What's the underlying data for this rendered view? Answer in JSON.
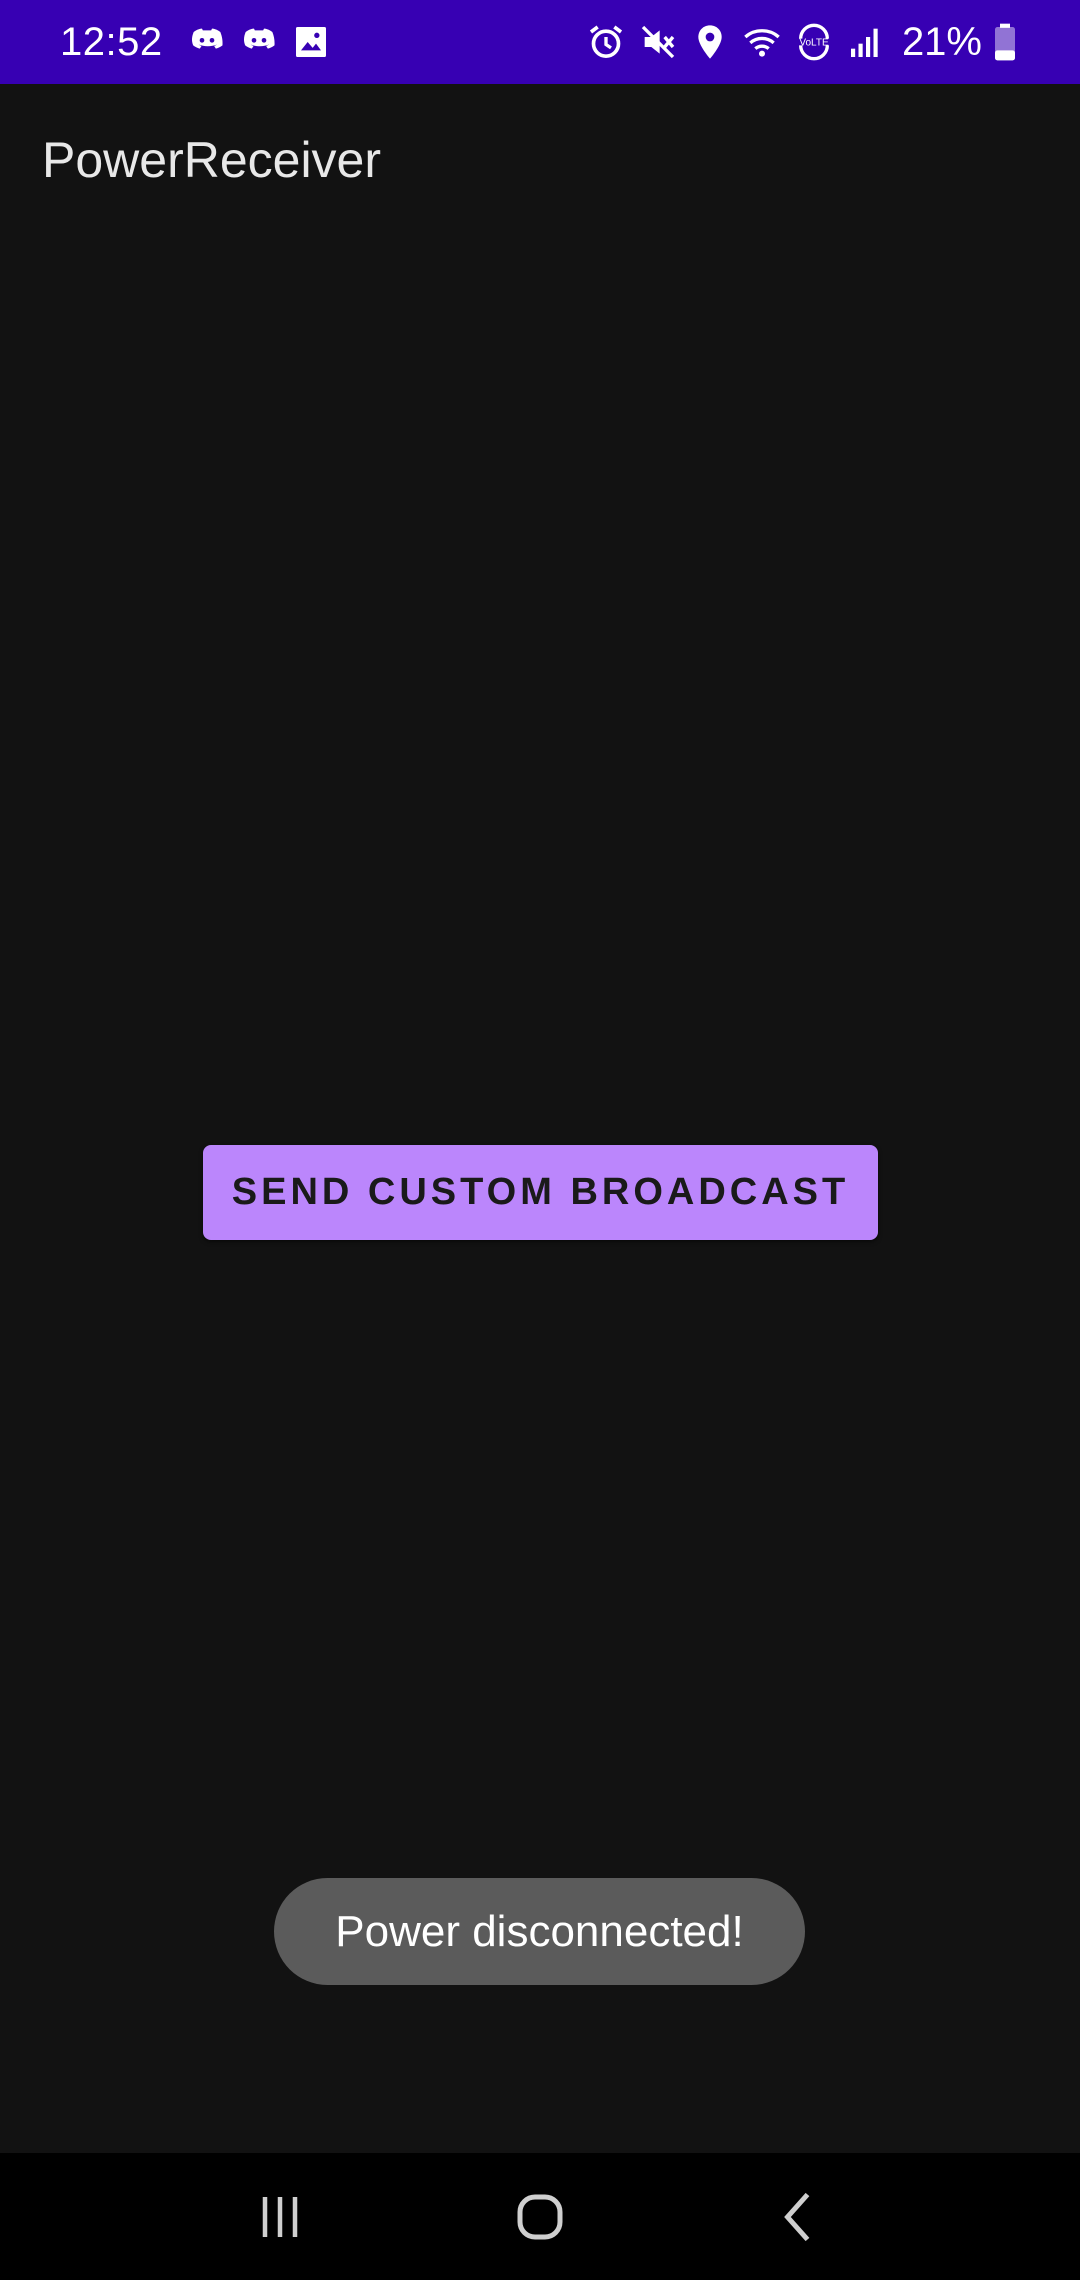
{
  "status_bar": {
    "time": "12:52",
    "notification_icons": [
      "discord-icon",
      "discord-icon",
      "image-icon"
    ],
    "system_icons": [
      "alarm-icon",
      "mute-icon",
      "location-icon",
      "wifi-icon",
      "volte-icon",
      "signal-icon"
    ],
    "battery_percent": "21%",
    "background_color": "#3700b3"
  },
  "app_bar": {
    "title": "PowerReceiver"
  },
  "main": {
    "button_label": "SEND CUSTOM BROADCAST",
    "button_color": "#bb86fc"
  },
  "toast": {
    "message": "Power disconnected!"
  },
  "nav_bar": {
    "buttons": [
      "recent-apps-icon",
      "home-icon",
      "back-icon"
    ]
  }
}
